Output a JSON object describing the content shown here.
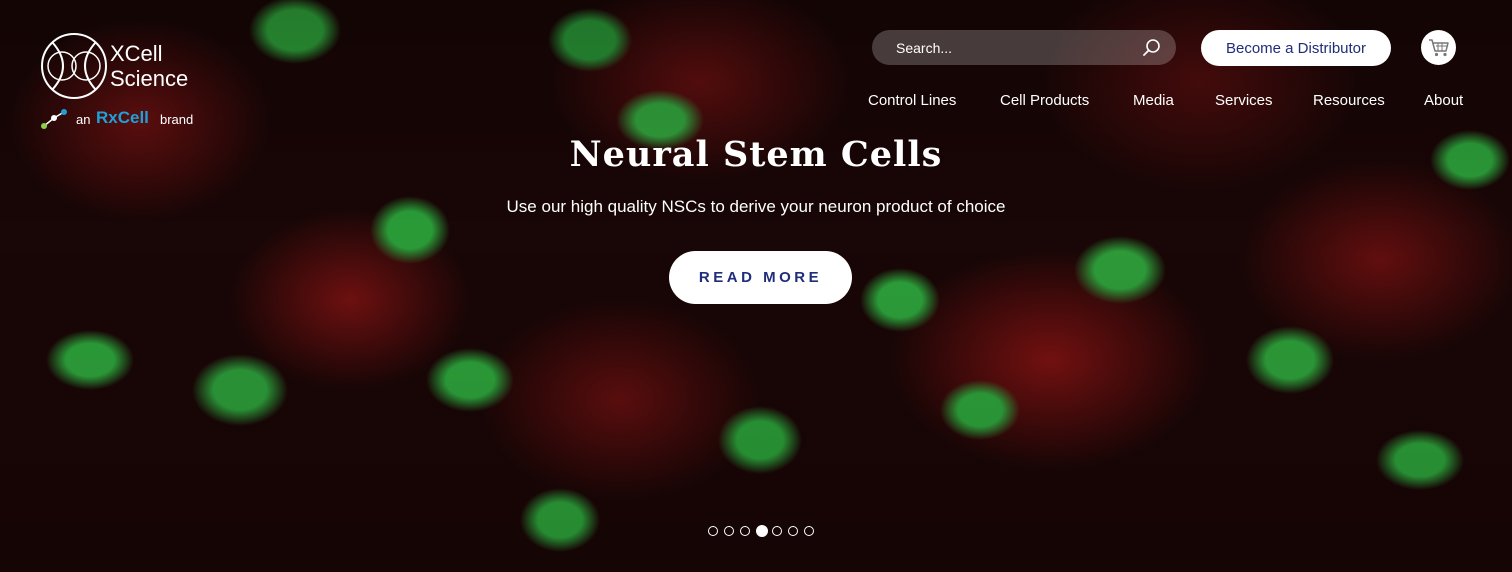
{
  "logo": {
    "line1": "XCell",
    "line2": "Science",
    "an": "an",
    "rxcell": "RxCell",
    "brand": "brand"
  },
  "search": {
    "placeholder": "Search..."
  },
  "header": {
    "distributor_label": "Become a Distributor"
  },
  "nav": {
    "items": [
      {
        "label": "Control Lines"
      },
      {
        "label": "Cell Products"
      },
      {
        "label": "Media"
      },
      {
        "label": "Services"
      },
      {
        "label": "Resources"
      },
      {
        "label": "About"
      }
    ]
  },
  "slide": {
    "title": "Neural Stem Cells",
    "subtitle": "Use our high quality NSCs to derive your neuron product of choice",
    "cta_label": "READ MORE"
  },
  "carousel": {
    "dot_count": 7,
    "active_index": 3
  },
  "colors": {
    "accent": "#1f2d7a",
    "rxcell_blue": "#1fa0d8"
  },
  "icons": [
    "search-icon",
    "cart-icon",
    "logo-mark-icon",
    "molecule-icon"
  ]
}
